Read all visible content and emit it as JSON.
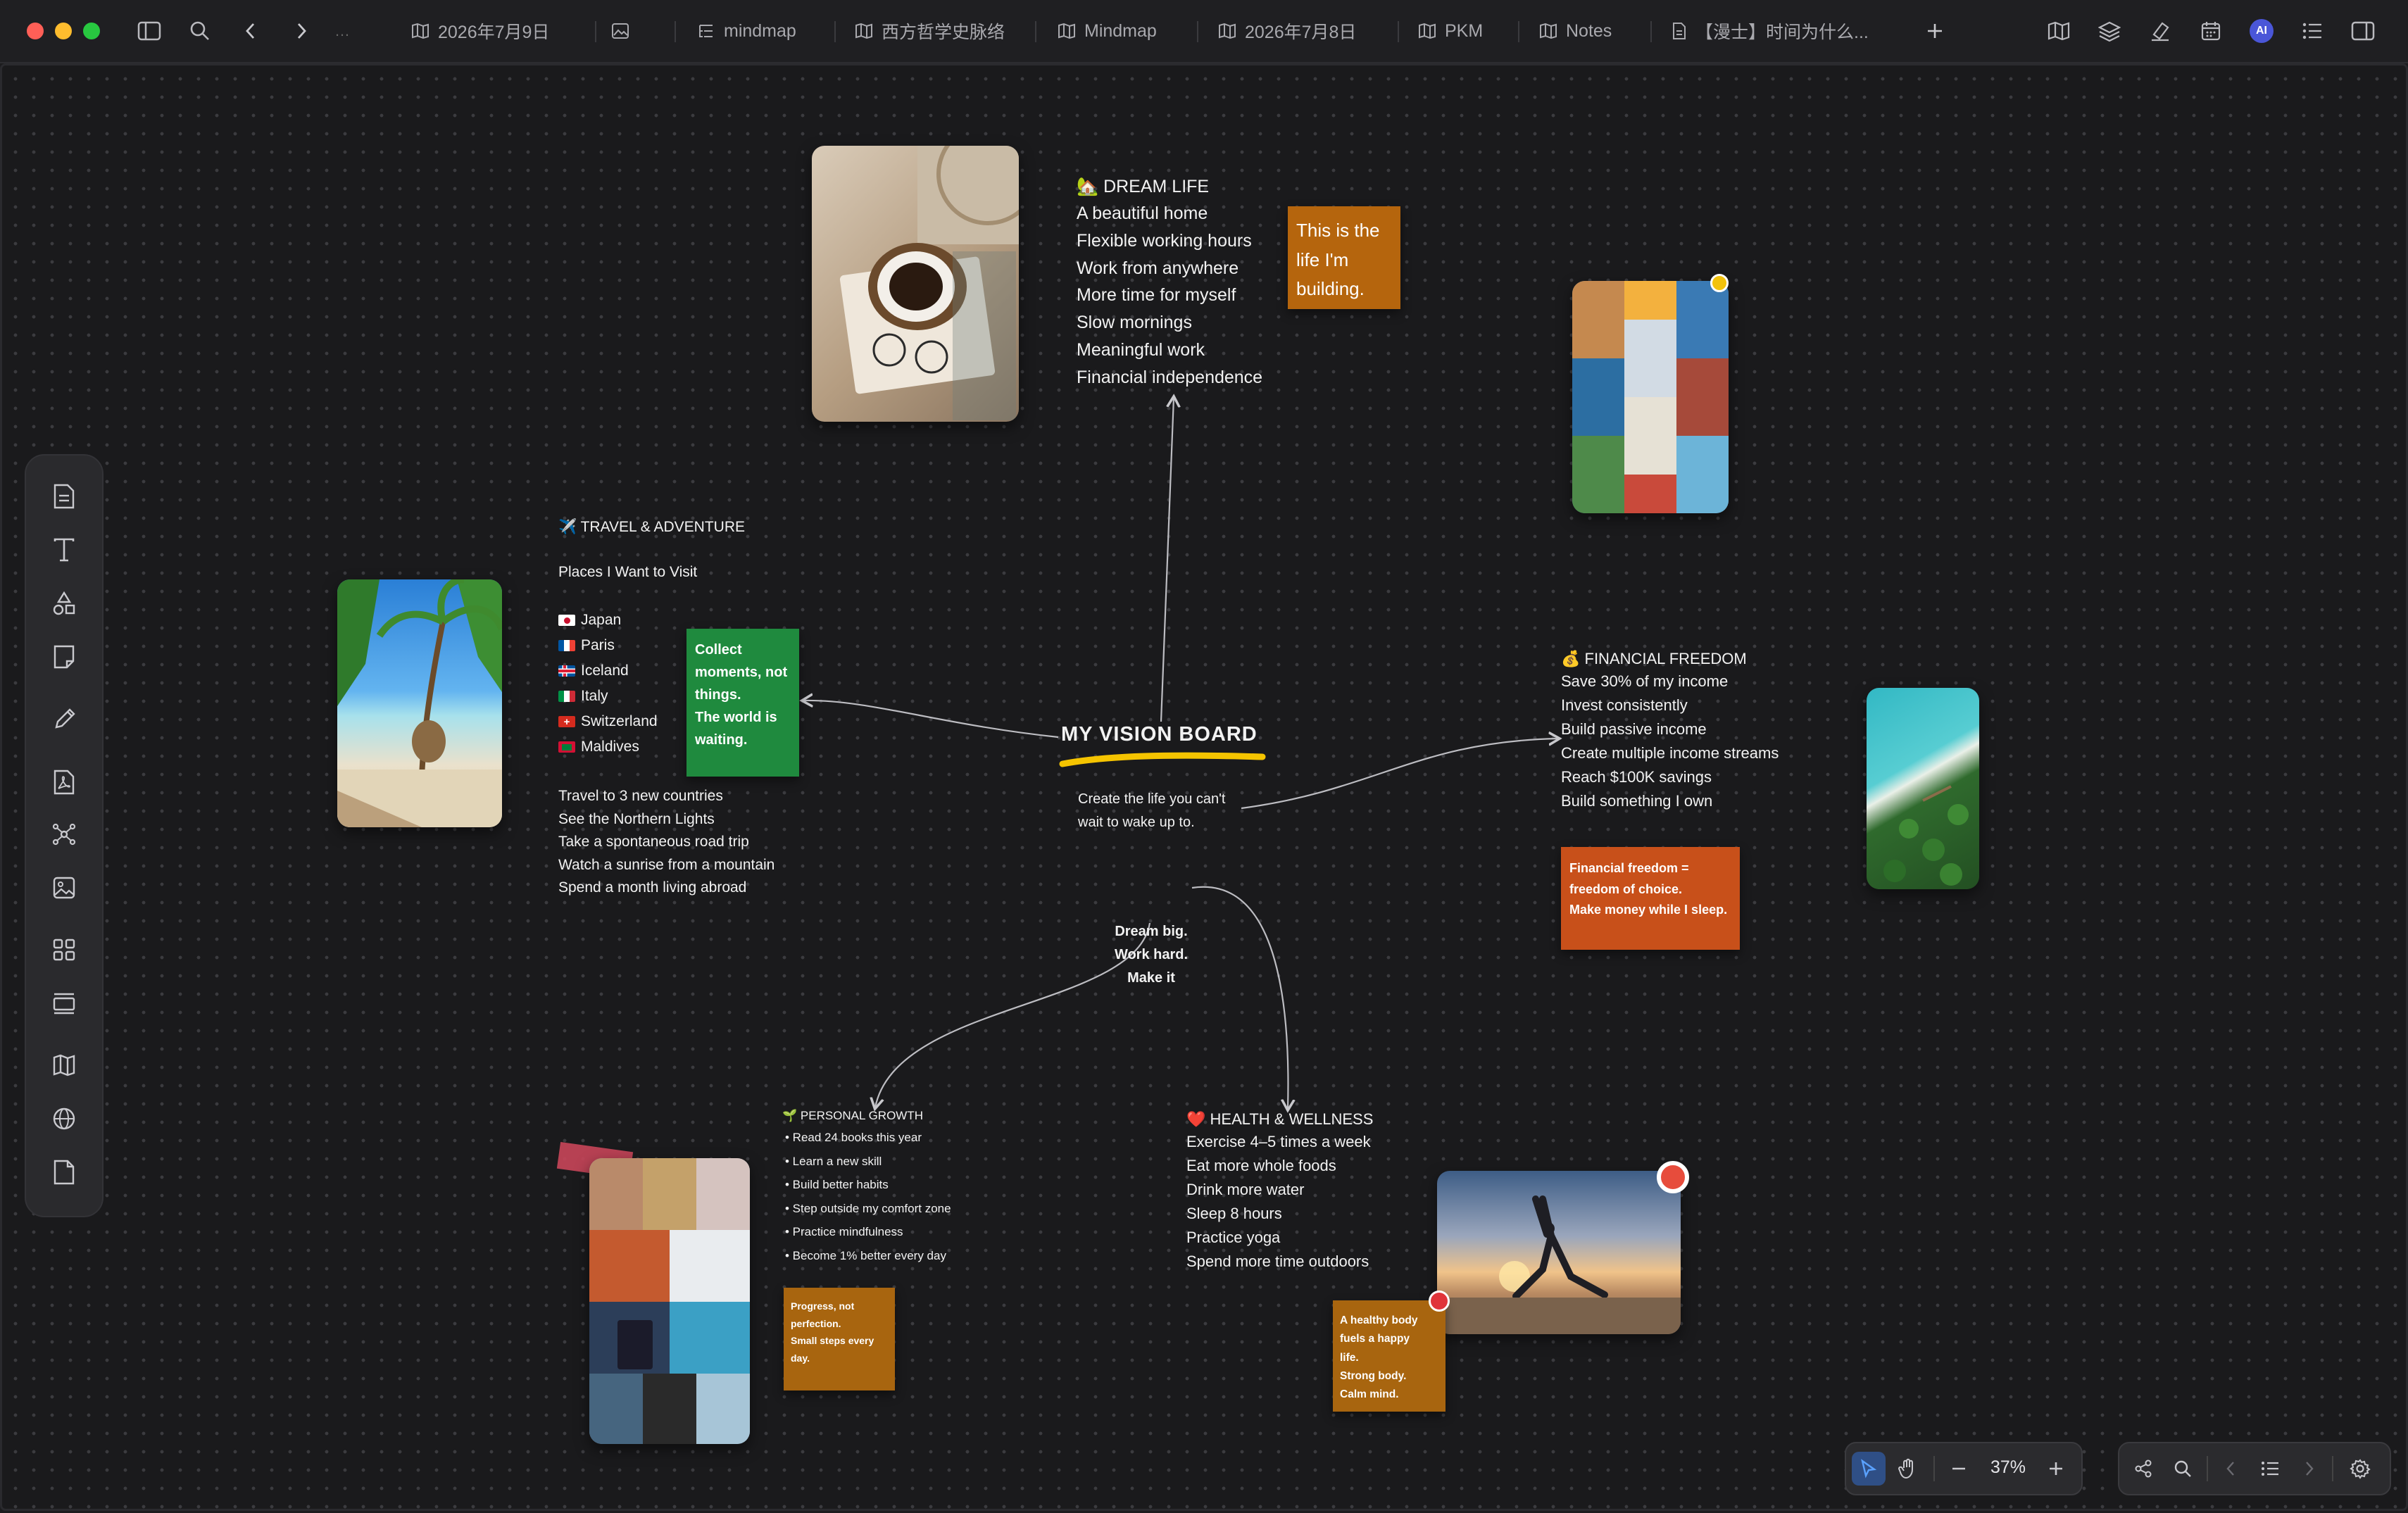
{
  "window": {
    "traffic_colors": {
      "close": "#ff5f57",
      "minimize": "#febc2e",
      "zoom": "#28c840"
    }
  },
  "tabs": [
    {
      "label": "2026年7月9日",
      "icon": "map-icon"
    },
    {
      "label": "",
      "icon": "image-icon"
    },
    {
      "label": "mindmap",
      "icon": "outline-icon"
    },
    {
      "label": "西方哲学史脉络",
      "icon": "map-icon"
    },
    {
      "label": "Mindmap",
      "icon": "map-icon"
    },
    {
      "label": "2026年7月8日",
      "icon": "map-icon"
    },
    {
      "label": "PKM",
      "icon": "map-icon"
    },
    {
      "label": "Notes",
      "icon": "map-icon"
    },
    {
      "label": "【漫士】时间为什么...",
      "icon": "document-icon"
    }
  ],
  "ai_badge": "AI",
  "board": {
    "center_title": "MY VISION BOARD",
    "center_subtitle_lines": [
      "Create the life you can't",
      "wait to wake up to."
    ],
    "motto_lines": [
      "Dream big.",
      "Work hard.",
      "Make it"
    ],
    "dream": {
      "title": "🏡 DREAM LIFE",
      "items": [
        "A beautiful home",
        "Flexible working hours",
        "Work from anywhere",
        "More time for myself",
        "Slow mornings",
        "Meaningful work",
        "Financial independence"
      ],
      "sticky": [
        "This is the",
        "life I'm",
        "building."
      ]
    },
    "travel": {
      "title": "✈️ TRAVEL & ADVENTURE",
      "places_heading": "Places I Want to Visit",
      "places": [
        {
          "name": "Japan",
          "flag": "japan-flag"
        },
        {
          "name": "Paris",
          "flag": "france-flag"
        },
        {
          "name": "Iceland",
          "flag": "iceland-flag"
        },
        {
          "name": "Italy",
          "flag": "italy-flag"
        },
        {
          "name": "Switzerland",
          "flag": "switzerland-flag"
        },
        {
          "name": "Maldives",
          "flag": "maldives-flag"
        }
      ],
      "goals": [
        "Travel to 3 new countries",
        "See the Northern Lights",
        "Take a spontaneous road trip",
        "Watch a sunrise from a mountain",
        "Spend a month living abroad"
      ],
      "sticky": [
        "Collect",
        "moments, not",
        "things.",
        "The world is",
        "waiting."
      ]
    },
    "finance": {
      "title": "💰 FINANCIAL FREEDOM",
      "items": [
        "Save 30% of my income",
        "Invest consistently",
        "Build passive income",
        "Create multiple income streams",
        "Reach $100K savings",
        "Build something I own"
      ],
      "sticky": [
        "Financial freedom =",
        "freedom of choice.",
        "Make money while I sleep."
      ]
    },
    "growth": {
      "title": "🌱 PERSONAL GROWTH",
      "items": [
        "• Read 24 books this year",
        "• Learn a new skill",
        "• Build better habits",
        "• Step outside my comfort zone",
        "• Practice mindfulness",
        "• Become 1% better every day"
      ],
      "sticky": [
        "Progress, not",
        "perfection.",
        "Small steps every",
        "day."
      ]
    },
    "health": {
      "title": "❤️ HEALTH & WELLNESS",
      "items": [
        "Exercise 4–5 times a week",
        "Eat more whole foods",
        "Drink more water",
        "Sleep 8 hours",
        "Practice yoga",
        "Spend more time outdoors"
      ],
      "sticky": [
        "A healthy body",
        "fuels a happy",
        "life.",
        "Strong body.",
        "Calm mind."
      ]
    }
  },
  "zoom": {
    "value": "37%"
  },
  "colors": {
    "sticky_orange": "#b5650d",
    "sticky_green": "#1f8a3e",
    "sticky_red": "#c8501a",
    "sticky_amber": "#a8650f",
    "underline_yellow": "#f5c400"
  }
}
